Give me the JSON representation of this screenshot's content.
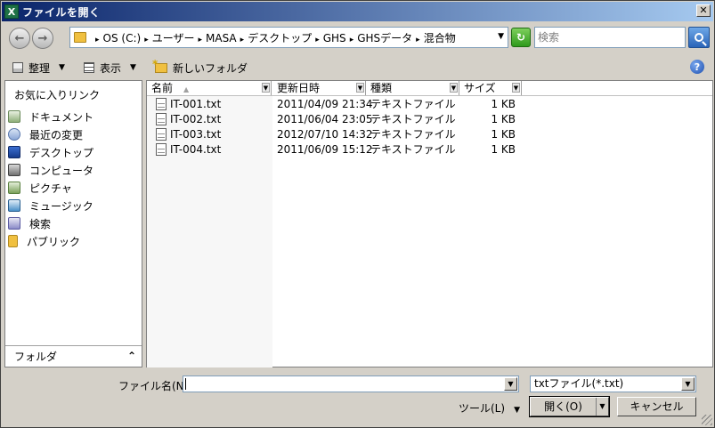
{
  "window": {
    "title": "ファイルを開く",
    "app_icon_letter": "X",
    "close_glyph": "✕"
  },
  "nav": {
    "back_glyph": "←",
    "forward_glyph": "→"
  },
  "address": {
    "crumbs": [
      "OS (C:)",
      "ユーザー",
      "MASA",
      "デスクトップ",
      "GHS",
      "GHSデータ",
      "混合物"
    ],
    "separator": "▸",
    "dropdown_glyph": "▼"
  },
  "refresh_glyph": "↻",
  "search": {
    "placeholder": "検索"
  },
  "toolbar": {
    "organize_label": "整理",
    "views_label": "表示",
    "new_folder_label": "新しいフォルダ",
    "dropdown_glyph": "▼",
    "help_glyph": "?"
  },
  "navpane": {
    "title": "お気に入りリンク",
    "items": [
      {
        "label": "ドキュメント",
        "icon": "documents-icon"
      },
      {
        "label": "最近の変更",
        "icon": "recent-icon"
      },
      {
        "label": "デスクトップ",
        "icon": "desktop-icon"
      },
      {
        "label": "コンピュータ",
        "icon": "computer-icon"
      },
      {
        "label": "ピクチャ",
        "icon": "pictures-icon"
      },
      {
        "label": "ミュージック",
        "icon": "music-icon"
      },
      {
        "label": "検索",
        "icon": "search-folder-icon"
      },
      {
        "label": "パブリック",
        "icon": "public-folder-icon"
      }
    ],
    "folder_label": "フォルダ",
    "folder_chevron": "⌃"
  },
  "columns": {
    "name": "名前",
    "modified": "更新日時",
    "type": "種類",
    "size": "サイズ",
    "sort_glyph": "▲",
    "drop_glyph": "▼"
  },
  "files": [
    {
      "name": "IT-001.txt",
      "modified": "2011/04/09 21:34",
      "type": "テキストファイル",
      "size": "1 KB"
    },
    {
      "name": "IT-002.txt",
      "modified": "2011/06/04 23:05",
      "type": "テキストファイル",
      "size": "1 KB"
    },
    {
      "name": "IT-003.txt",
      "modified": "2012/07/10 14:32",
      "type": "テキストファイル",
      "size": "1 KB"
    },
    {
      "name": "IT-004.txt",
      "modified": "2011/06/09 15:12",
      "type": "テキストファイル",
      "size": "1 KB"
    }
  ],
  "bottom": {
    "filename_label": "ファイル名(N):",
    "filename_value": "",
    "filetype_value": "txtファイル(*.txt)",
    "tools_label": "ツール(L)",
    "open_label": "開く(O)",
    "cancel_label": "キャンセル",
    "dropdown_glyph": "▼"
  }
}
